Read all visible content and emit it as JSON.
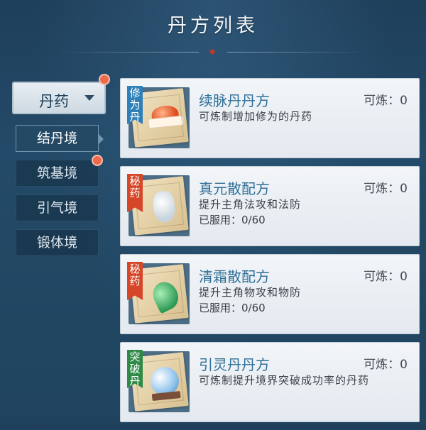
{
  "header": {
    "title": "丹方列表"
  },
  "category": {
    "selected": "丹药"
  },
  "side_nav": [
    {
      "label": "结丹境",
      "active": true
    },
    {
      "label": "筑基境",
      "active": false
    },
    {
      "label": "引气境",
      "active": false
    },
    {
      "label": "锻体境",
      "active": false
    }
  ],
  "recipes": [
    {
      "badge": "修为丹",
      "badge_color": "#2f7fb8",
      "icon": "red-pill-icon",
      "name": "续脉丹丹方",
      "craftable": "可炼：0",
      "desc": "可炼制增加修为的丹药",
      "used": ""
    },
    {
      "badge": "秘药",
      "badge_color": "#d6472a",
      "icon": "white-gourd-icon",
      "name": "真元散配方",
      "craftable": "可炼：0",
      "desc": "提升主角法攻和法防",
      "used": "已服用：0/60"
    },
    {
      "badge": "秘药",
      "badge_color": "#d6472a",
      "icon": "green-gourd-icon",
      "name": "清霜散配方",
      "craftable": "可炼：0",
      "desc": "提升主角物攻和物防",
      "used": "已服用：0/60"
    },
    {
      "badge": "突破丹",
      "badge_color": "#2f8a46",
      "icon": "blue-orb-icon",
      "name": "引灵丹丹方",
      "craftable": "可炼：0",
      "desc": "可炼制提升境界突破成功率的丹药",
      "used": ""
    }
  ]
}
